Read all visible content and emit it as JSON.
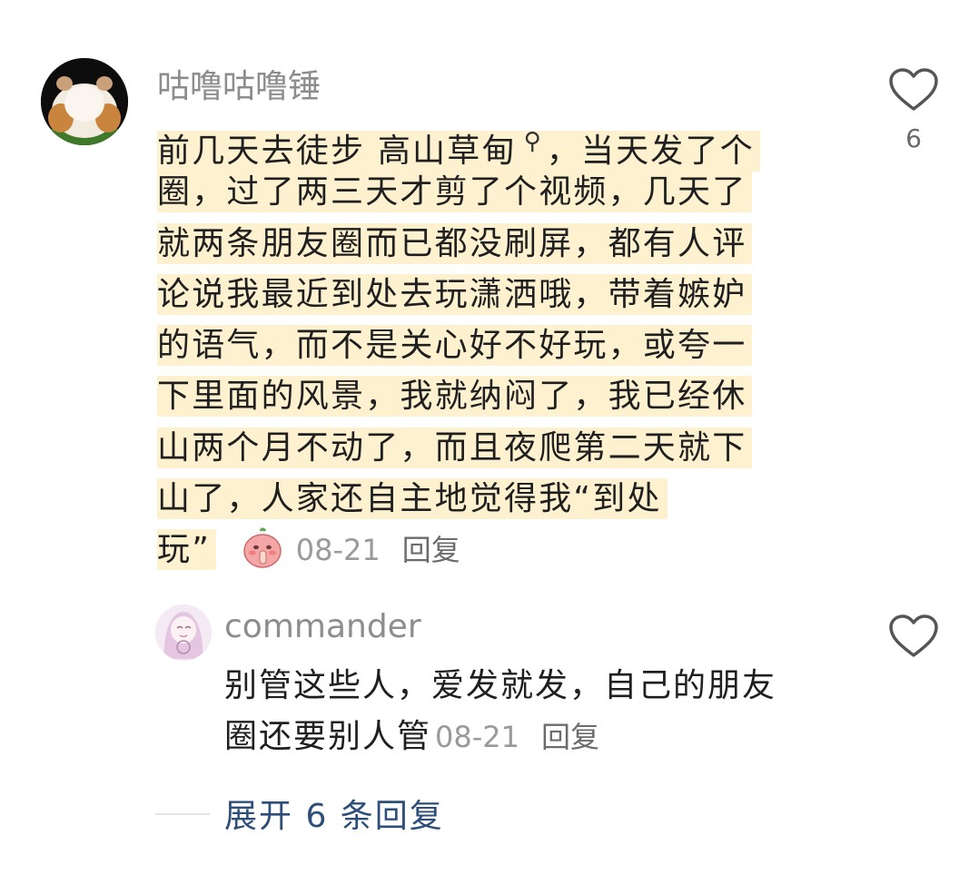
{
  "main_comment": {
    "username": "咕噜咕噜锤",
    "text_lines": [
      "前几天去徒步 高山草甸",
      "，当天发了个",
      "圈，过了两三天才剪了个视频，几天了",
      "就两条朋友圈而已都没刷屏，都有人评",
      "论说我最近到处去玩潇洒哦，带着嫉妒",
      "的语气，而不是关心好不好玩，或夸一",
      "下里面的风景，我就纳闷了，我已经休",
      "山两个月不动了，而且夜爬第二天就下",
      "山了，人家还自主地觉得我“到处",
      "玩”"
    ],
    "time": "08-21",
    "reply_label": "回复",
    "like_count": "6",
    "highlight_color": "#fdf1cf"
  },
  "reply_comment": {
    "username": "commander",
    "text_lines": [
      "别管这些人，爱发就发，自己的朋友",
      "圈还要别人管"
    ],
    "time": "08-21",
    "reply_label": "回复"
  },
  "expand": {
    "label": "展开 6 条回复"
  },
  "colors": {
    "link": "#2d4e79",
    "username": "#8d8d8d",
    "meta": "#9a9a9a"
  }
}
